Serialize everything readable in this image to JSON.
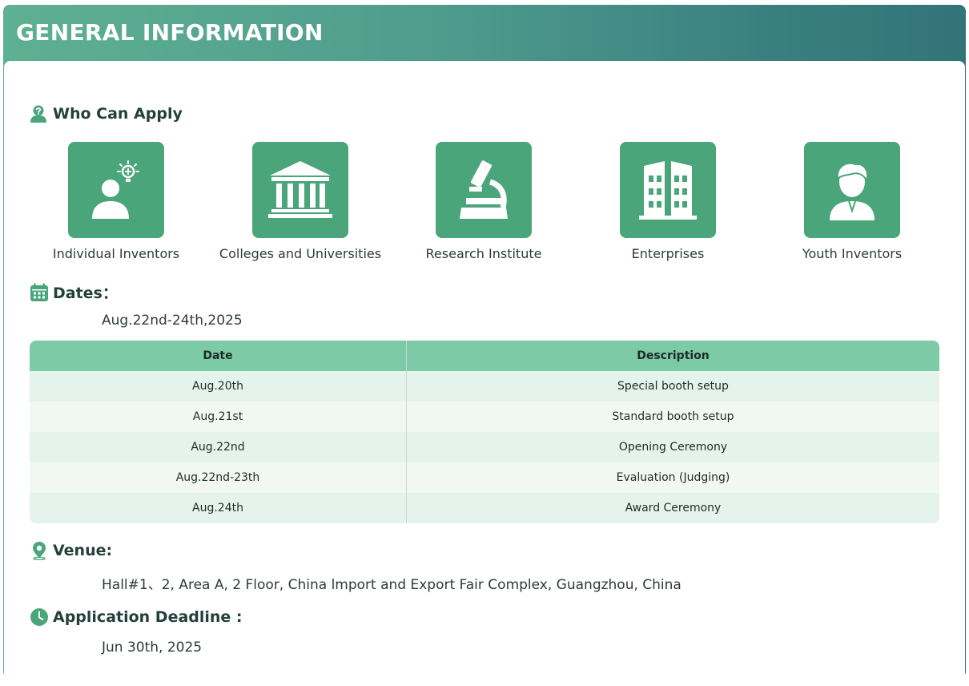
{
  "header": {
    "title": "GENERAL INFORMATION"
  },
  "sections": {
    "who_can_apply": {
      "title": "Who Can Apply",
      "items": [
        {
          "label": "Individual Inventors",
          "icon": "inventor-lightbulb-icon"
        },
        {
          "label": "Colleges and Universities",
          "icon": "university-building-icon"
        },
        {
          "label": "Research Institute",
          "icon": "microscope-icon"
        },
        {
          "label": "Enterprises",
          "icon": "office-building-icon"
        },
        {
          "label": "Youth Inventors",
          "icon": "youth-person-icon"
        }
      ]
    },
    "dates": {
      "title": "Dates：",
      "value": "Aug.22nd-24th,2025",
      "table": {
        "headers": [
          "Date",
          "Description"
        ],
        "rows": [
          [
            "Aug.20th",
            "Special booth setup"
          ],
          [
            "Aug.21st",
            "Standard booth setup"
          ],
          [
            "Aug.22nd",
            "Opening Ceremony"
          ],
          [
            "Aug.22nd-23th",
            "Evaluation (Judging)"
          ],
          [
            "Aug.24th",
            "Award Ceremony"
          ]
        ]
      }
    },
    "venue": {
      "title": "Venue:",
      "value": "Hall#1、2, Area A, 2 Floor, China lmport and Export Fair Complex, Guangzhou, China"
    },
    "deadline": {
      "title": "Application Deadline :",
      "value": "Jun 30th, 2025"
    }
  },
  "colors": {
    "accent": "#4aa57a",
    "table_header": "#7ccaa6",
    "row_even": "#e4f4ec",
    "row_odd": "#f1f8f4"
  }
}
